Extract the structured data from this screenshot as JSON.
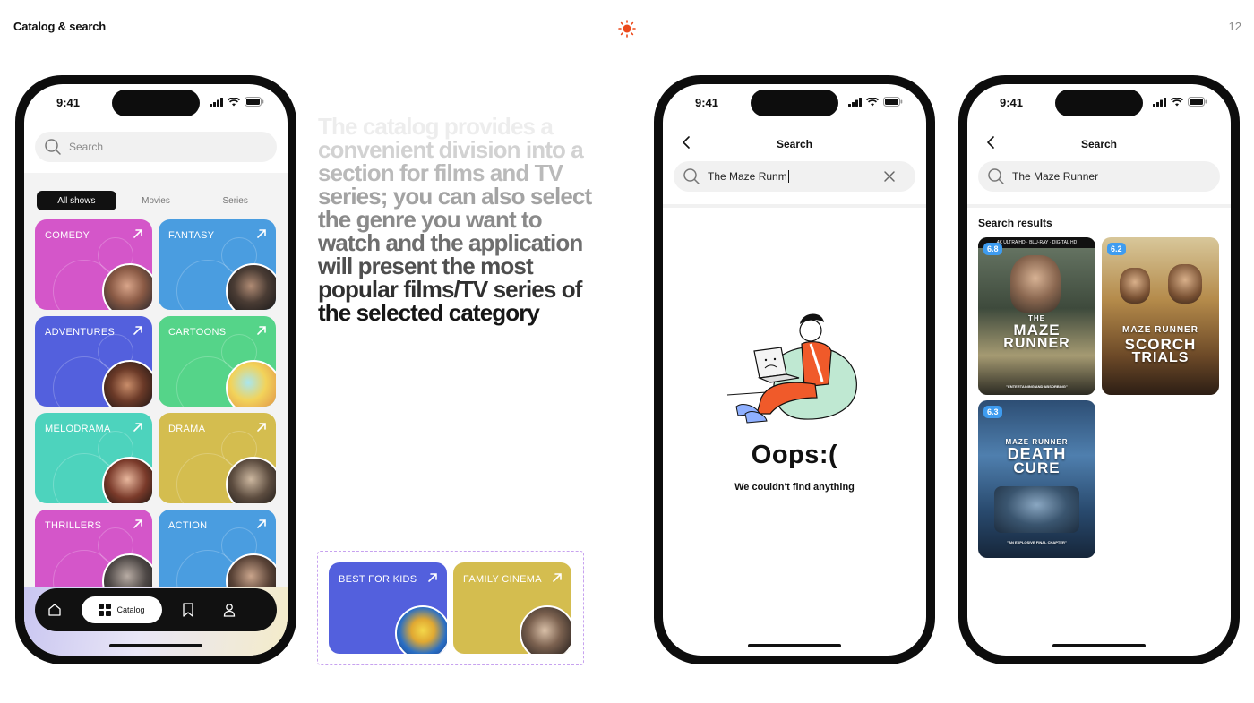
{
  "header": {
    "title": "Catalog & search",
    "page_number": "12"
  },
  "description_lines": [
    "The catalog provides a",
    "convenient division into a",
    "section for films and TV",
    "series; you can also select",
    "the genre you want to",
    "watch and the application",
    "will present the most",
    "popular films/TV series of",
    "the selected category"
  ],
  "catalog_phone": {
    "status_time": "9:41",
    "search_placeholder": "Search",
    "segments": [
      "All shows",
      "Movies",
      "Series"
    ],
    "active_segment": "All shows",
    "genres": [
      {
        "label": "COMEDY",
        "color": "#d456c9"
      },
      {
        "label": "FANTASY",
        "color": "#4a9de0"
      },
      {
        "label": "ADVENTURES",
        "color": "#5360dd"
      },
      {
        "label": "CARTOONS",
        "color": "#55d489"
      },
      {
        "label": "MELODRAMA",
        "color": "#4dd3bd"
      },
      {
        "label": "DRAMA",
        "color": "#d4bd4f"
      },
      {
        "label": "THRILLERS",
        "color": "#d456c9"
      },
      {
        "label": "ACTION",
        "color": "#4a9de0"
      }
    ],
    "tabbar": {
      "active_label": "Catalog",
      "icons": [
        "home-icon",
        "catalog-icon",
        "bookmark-icon",
        "profile-icon"
      ]
    }
  },
  "extra_categories": [
    {
      "label": "BEST FOR KIDS",
      "color": "#5360dd"
    },
    {
      "label": "FAMILY CINEMA",
      "color": "#d4bd4f"
    }
  ],
  "empty_search_phone": {
    "status_time": "9:41",
    "nav_title": "Search",
    "query": "The Maze Runm",
    "empty_title": "Oops:(",
    "empty_message": "We couldn't find anything"
  },
  "results_phone": {
    "status_time": "9:41",
    "nav_title": "Search",
    "query": "The Maze Runner",
    "results_title": "Search results",
    "results": [
      {
        "rating": "6.8",
        "poster_top": "THE",
        "poster_title_1": "MAZE",
        "poster_title_2": "RUNNER",
        "poster_tagline": "\"ENTERTAINING AND ABSORBING\"",
        "poster_badge": "4K ULTRA HD · BLU-RAY · DIGITAL HD"
      },
      {
        "rating": "6.2",
        "poster_top": "MAZE RUNNER",
        "poster_title_1": "SCORCH",
        "poster_title_2": "TRIALS",
        "poster_tagline": "",
        "poster_badge": ""
      },
      {
        "rating": "6.3",
        "poster_top": "MAZE RUNNER",
        "poster_title_1": "DEATH",
        "poster_title_2": "CURE",
        "poster_tagline": "\"AN EXPLOSIVE FINAL CHAPTER\"",
        "poster_badge": ""
      }
    ]
  }
}
